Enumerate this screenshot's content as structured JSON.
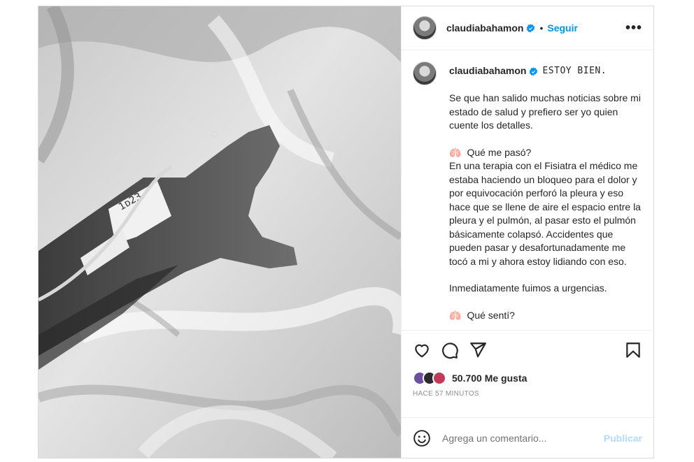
{
  "post": {
    "username": "claudiabahamon",
    "dot": "•",
    "follow_label": "Seguir",
    "more_label": "•••"
  },
  "caption": {
    "username": "claudiabahamon",
    "headline": "ESTOY BIEN.",
    "paragraph1": "Se que han salido muchas noticias sobre mi estado de salud y prefiero ser yo quien cuente los detalles.",
    "section1_emoji": "🫁",
    "section1_title": "Qué me pasó?",
    "paragraph2": "En una terapia con el Fisiatra el médico me estaba haciendo un bloqueo para el dolor y por equivocación perforó la pleura y eso hace que se llene de aire el espacio entre la pleura y el pulmón, al pasar esto el pulmón básicamente colapsó. Accidentes que pueden pasar y desafortunadamente me tocó a mi y ahora estoy lidiando con eso.",
    "paragraph3": "Inmediatamente fuimos a urgencias.",
    "section2_emoji": "🫁",
    "section2_title": "Qué sentí?"
  },
  "icons": {
    "like": "heart-icon",
    "comment": "comment-icon",
    "share": "send-icon",
    "save": "bookmark-icon",
    "emoji": "emoji-icon",
    "verified": "verified-badge-icon"
  },
  "engagement": {
    "likes_text": "50.700 Me gusta",
    "time_text": "HACE 57 MINUTOS"
  },
  "comment_box": {
    "placeholder": "Agrega un comentario...",
    "publish_label": "Publicar"
  },
  "colors": {
    "accent": "#0095f6",
    "verified": "#0095f6",
    "publish_disabled": "#b3dbff",
    "text": "#262626",
    "muted": "#8e8e8e"
  }
}
